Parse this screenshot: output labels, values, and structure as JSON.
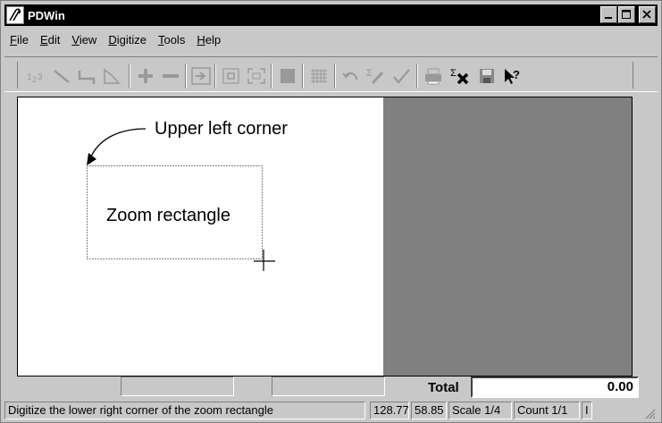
{
  "window": {
    "title": "PDWin"
  },
  "menu": [
    {
      "label": "File",
      "underline": "F",
      "rest": "ile"
    },
    {
      "label": "Edit",
      "underline": "E",
      "rest": "dit"
    },
    {
      "label": "View",
      "underline": "V",
      "rest": "iew"
    },
    {
      "label": "Digitize",
      "underline": "D",
      "rest": "igitize"
    },
    {
      "label": "Tools",
      "underline": "T",
      "rest": "ools"
    },
    {
      "label": "Help",
      "underline": "H",
      "rest": "elp"
    }
  ],
  "toolbar": {
    "tools": [
      "number-sequence-icon",
      "line-icon",
      "polyline-icon",
      "area-icon",
      "plus-icon",
      "minus-icon",
      "import-icon",
      "zoom-window-icon",
      "zoom-extents-icon",
      "fill-icon",
      "grid-icon",
      "undo-icon",
      "sum-pencil-icon",
      "check-icon",
      "print-icon",
      "sum-clear-icon",
      "save-icon",
      "help-icon"
    ]
  },
  "canvas": {
    "annotation_label": "Upper left corner",
    "rectangle_label": "Zoom rectangle"
  },
  "totals": {
    "label": "Total",
    "value": "0.00"
  },
  "status": {
    "message": "Digitize the lower right corner of the zoom rectangle",
    "x": "128.77",
    "y": "58.85",
    "scale": "Scale  1/4",
    "count": "Count  1/1",
    "extra": "I"
  },
  "colors": {
    "titlebar": "#000000",
    "chrome": "#c8c8c8",
    "canvas": "#ffffff",
    "preview": "#808080"
  }
}
